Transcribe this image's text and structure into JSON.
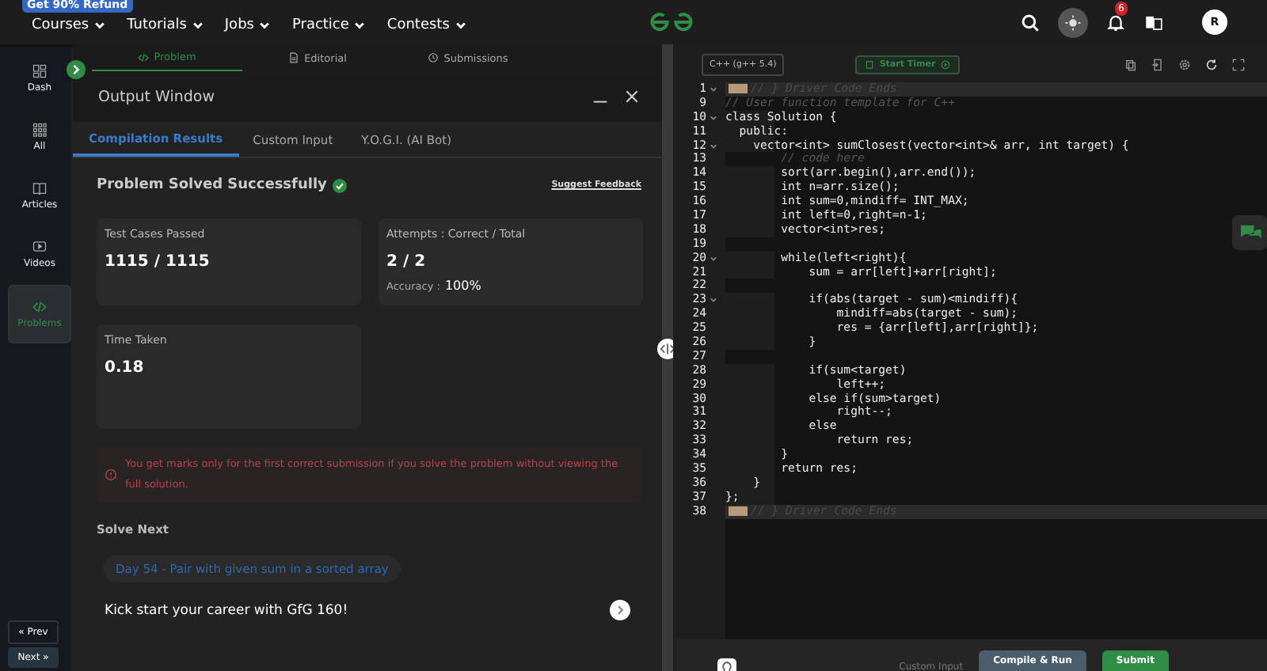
{
  "promo": "Get 90% Refund",
  "nav": [
    {
      "label": "Courses"
    },
    {
      "label": "Tutorials"
    },
    {
      "label": "Jobs"
    },
    {
      "label": "Practice"
    },
    {
      "label": "Contests"
    }
  ],
  "notifications": "6",
  "avatar": "R",
  "sidebar": {
    "items": [
      {
        "label": "Dash",
        "selected": false
      },
      {
        "label": "All",
        "selected": false
      },
      {
        "label": "Articles",
        "selected": false
      },
      {
        "label": "Videos",
        "selected": false
      },
      {
        "label": "Problems",
        "selected": true
      }
    ],
    "prev": "« Prev",
    "next": "Next »"
  },
  "problem_tabs": [
    {
      "label": "Problem",
      "selected": true
    },
    {
      "label": "Editorial",
      "selected": false
    },
    {
      "label": "Submissions",
      "selected": false
    }
  ],
  "output_window": {
    "title": "Output Window",
    "tabs": [
      {
        "label": "Compilation Results",
        "selected": true
      },
      {
        "label": "Custom Input",
        "selected": false
      },
      {
        "label": "Y.O.G.I. (AI Bot)",
        "selected": false
      }
    ],
    "status": "Problem Solved Successfully",
    "feedback": "Suggest Feedback",
    "cards": [
      {
        "label": "Test Cases Passed",
        "value": "1115 / 1115"
      },
      {
        "label": "Attempts : Correct / Total",
        "value": "2 / 2",
        "extra_label": "Accuracy :",
        "extra_value": "100%"
      },
      {
        "label": "Time Taken",
        "value": "0.18"
      }
    ],
    "warning": "You get marks only for the first correct submission if you solve the problem without viewing the full solution.",
    "solve_next": "Solve Next",
    "next_problem": "Day 54 - Pair with given sum in a sorted array",
    "promo_row": "Kick start your career with GfG 160!"
  },
  "editor": {
    "language": "C++ (g++ 5.4)",
    "timer": "Start Timer",
    "lines": [
      {
        "no": "1",
        "text": "// } Driver Code Ends",
        "kind": "folded",
        "fold": true
      },
      {
        "no": "9",
        "text": "// User function template for C++",
        "kind": "comment",
        "fold": false
      },
      {
        "no": "10",
        "text": "class Solution {",
        "kind": "code",
        "fold": true
      },
      {
        "no": "11",
        "text": "  public:",
        "kind": "code",
        "fold": false
      },
      {
        "no": "12",
        "text": "    vector<int> sumClosest(vector<int>& arr, int target) {",
        "kind": "code",
        "fold": true
      },
      {
        "no": "13",
        "text": "        // code here",
        "kind": "comment",
        "fold": false
      },
      {
        "no": "14",
        "text": "        sort(arr.begin(),arr.end());",
        "kind": "code",
        "fold": false
      },
      {
        "no": "15",
        "text": "        int n=arr.size();",
        "kind": "code",
        "fold": false
      },
      {
        "no": "16",
        "text": "        int sum=0,mindiff= INT_MAX;",
        "kind": "code",
        "fold": false
      },
      {
        "no": "17",
        "text": "        int left=0,right=n-1;",
        "kind": "code",
        "fold": false
      },
      {
        "no": "18",
        "text": "        vector<int>res;",
        "kind": "code",
        "fold": false
      },
      {
        "no": "19",
        "kind": "code",
        "fold": false
      },
      {
        "no": "20",
        "text": "        while(left<right){",
        "kind": "code",
        "fold": true
      },
      {
        "no": "21",
        "text": "            sum = arr[left]+arr[right];",
        "kind": "code",
        "fold": false
      },
      {
        "no": "22",
        "kind": "code",
        "fold": false
      },
      {
        "no": "23",
        "text": "            if(abs(target - sum)<mindiff){",
        "kind": "code",
        "fold": true
      },
      {
        "no": "24",
        "text": "                mindiff=abs(target - sum);",
        "kind": "code",
        "fold": false
      },
      {
        "no": "25",
        "text": "                res = {arr[left],arr[right]};",
        "kind": "code",
        "fold": false
      },
      {
        "no": "26",
        "text": "            }",
        "kind": "code",
        "fold": false
      },
      {
        "no": "27",
        "kind": "code",
        "fold": false
      },
      {
        "no": "28",
        "text": "            if(sum<target)",
        "kind": "code",
        "fold": false
      },
      {
        "no": "29",
        "text": "                left++;",
        "kind": "code",
        "fold": false
      },
      {
        "no": "30",
        "text": "            else if(sum>target)",
        "kind": "code",
        "fold": false
      },
      {
        "no": "31",
        "text": "                right--;",
        "kind": "code",
        "fold": false
      },
      {
        "no": "32",
        "text": "            else",
        "kind": "code",
        "fold": false
      },
      {
        "no": "33",
        "text": "                return res;",
        "kind": "code",
        "fold": false
      },
      {
        "no": "34",
        "text": "        }",
        "kind": "code",
        "fold": false
      },
      {
        "no": "35",
        "text": "        return res;",
        "kind": "code",
        "fold": false
      },
      {
        "no": "36",
        "text": "    }",
        "kind": "code",
        "fold": false
      },
      {
        "no": "37",
        "text": "};",
        "kind": "code",
        "fold": false
      },
      {
        "no": "38",
        "text": "// } Driver Code Ends",
        "kind": "folded",
        "fold": false
      }
    ],
    "custom_input": "Custom Input",
    "compile": "Compile & Run",
    "submit": "Submit"
  }
}
